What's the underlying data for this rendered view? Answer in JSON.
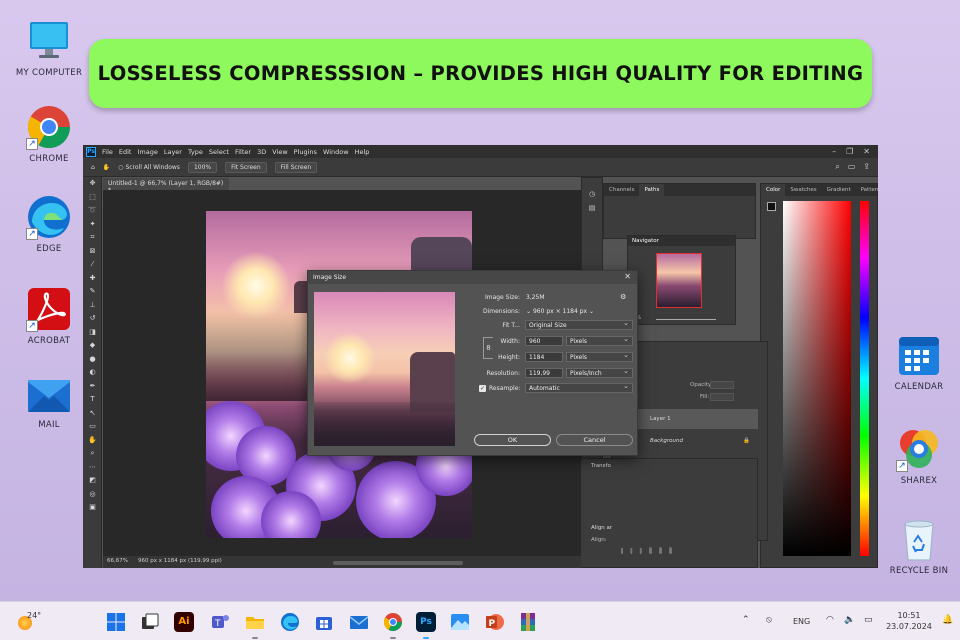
{
  "banner": {
    "text": "LOSSELESS COMPRESSSION – PROVIDES HIGH QUALITY FOR EDITING"
  },
  "desktop_icons": {
    "my_computer": "MY COMPUTER",
    "chrome": "CHROME",
    "edge": "EDGE",
    "acrobat": "ACROBAT",
    "mail": "MAIL",
    "calendar": "CALENDAR",
    "sharex": "SHAREX",
    "recycle_bin": "RECYCLE BIN"
  },
  "photoshop": {
    "logo": "Ps",
    "menu": [
      "File",
      "Edit",
      "Image",
      "Layer",
      "Type",
      "Select",
      "Filter",
      "3D",
      "View",
      "Plugins",
      "Window",
      "Help"
    ],
    "options": {
      "scroll_all_windows": "Scroll All Windows",
      "zoom_100": "100%",
      "fit_screen": "Fit Screen",
      "fill_screen": "Fill Screen"
    },
    "doc_tab": "Untitled-1 @ 66,7% (Layer 1, RGB/8#) *",
    "status": {
      "zoom": "66,67%",
      "size": "960 px x 1184 px (119,99 ppi)"
    },
    "panels": {
      "channels_tab": "Channels",
      "paths_tab": "Paths",
      "color_tab": "Color",
      "swatches_tab": "Swatches",
      "gradient_tab": "Gradient",
      "patterns_tab": "Patterns",
      "navigator_title": "Navigator",
      "navigator_zoom": "67%",
      "opacity_label": "Opacity:",
      "fill_label": "Fill:",
      "layer1": "Layer 1",
      "background_layer": "Background",
      "transform_title": "Transfo",
      "align_title": "Align ar",
      "align_label": "Align:"
    }
  },
  "image_size_dialog": {
    "title": "Image Size",
    "image_size_label": "Image Size:",
    "image_size_value": "3,25M",
    "dimensions_label": "Dimensions:",
    "dimensions_width": "960 px",
    "dimensions_sep": "×",
    "dimensions_height": "1184 px",
    "fit_to_label": "Fit T...",
    "fit_to_value": "Original Size",
    "width_label": "Width:",
    "width_value": "960",
    "width_unit": "Pixels",
    "height_label": "Height:",
    "height_value": "1184",
    "height_unit": "Pixels",
    "resolution_label": "Resolution:",
    "resolution_value": "119,99",
    "resolution_unit": "Pixels/Inch",
    "resample_label": "Resample:",
    "resample_value": "Automatic",
    "ok": "OK",
    "cancel": "Cancel"
  },
  "taskbar": {
    "weather": "24°",
    "language": "ENG",
    "time": "10:51",
    "date": "23.07.2024"
  },
  "colors": {
    "banner": "#8ef95c",
    "ps_bg": "#535353",
    "ps_accent": "#31a8ff"
  }
}
